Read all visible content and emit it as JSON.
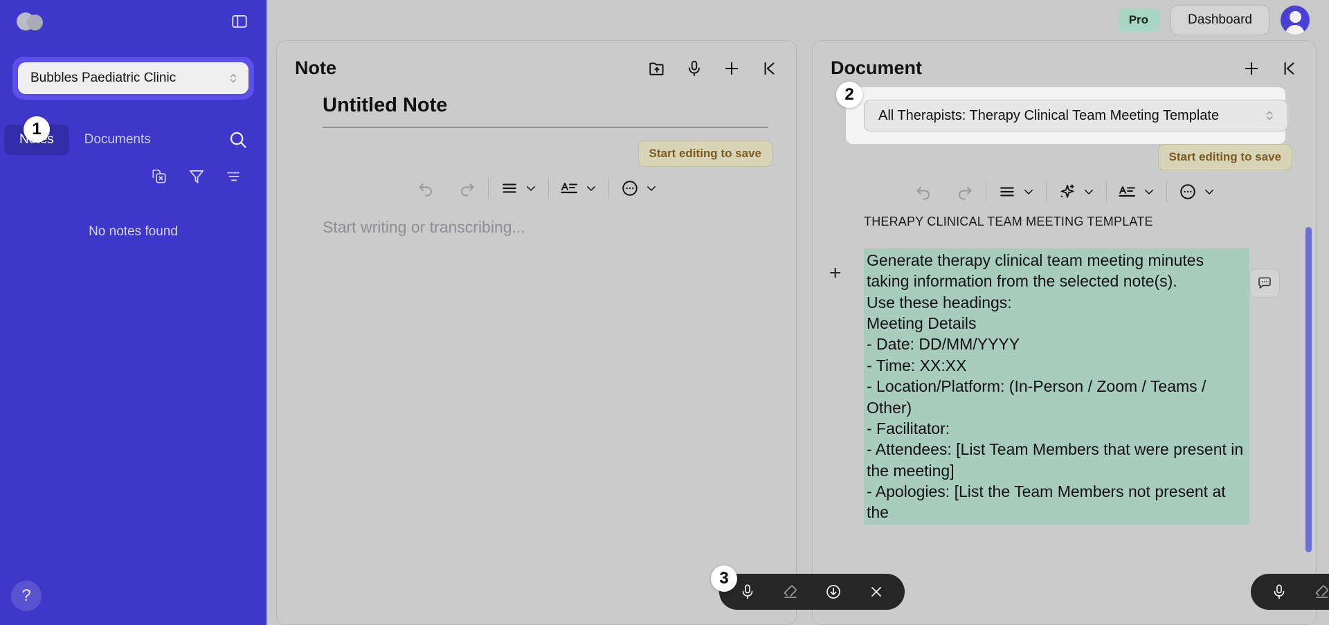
{
  "sidebar": {
    "logo_name": "bubbles-logo",
    "panel_toggle_name": "toggle-sidebar-icon",
    "clinic_selector": {
      "value": "Bubbles Paediatric Clinic",
      "badge": "1"
    },
    "tabs": [
      {
        "label": "Notes",
        "active": true
      },
      {
        "label": "Documents",
        "active": false
      }
    ],
    "search_icon": "search-icon",
    "tools": [
      {
        "name": "clear-selection-icon"
      },
      {
        "name": "filter-icon"
      },
      {
        "name": "sort-icon"
      }
    ],
    "empty_state": "No notes found",
    "help_label": "?"
  },
  "topbar": {
    "plan_badge": "Pro",
    "dashboard_label": "Dashboard",
    "avatar_name": "user-avatar"
  },
  "note_panel": {
    "title": "Note",
    "head_icons": [
      "folder-upload-icon",
      "microphone-icon",
      "plus-icon",
      "collapse-left-icon"
    ],
    "note_title": "Untitled Note",
    "save_badge": "Start editing to save",
    "toolbar": [
      {
        "name": "undo-icon",
        "dim": true
      },
      {
        "name": "redo-icon",
        "dim": true
      },
      {
        "name": "list-format-icon",
        "dim": false
      },
      {
        "name": "text-style-icon",
        "dim": false
      },
      {
        "name": "more-options-icon",
        "dim": false
      }
    ],
    "placeholder": "Start writing or transcribing...",
    "recorder_badge": "3",
    "recorder_buttons": [
      "microphone-icon",
      "eraser-icon",
      "download-icon",
      "close-icon"
    ]
  },
  "document_panel": {
    "title": "Document",
    "head_icons": [
      "plus-icon",
      "collapse-left-icon"
    ],
    "template_selector": {
      "value": "All Therapists: Therapy Clinical Team Meeting Template",
      "badge": "2"
    },
    "save_badge": "Start editing to save",
    "toolbar": [
      {
        "name": "undo-icon",
        "dim": true
      },
      {
        "name": "redo-icon",
        "dim": true
      },
      {
        "name": "list-format-icon",
        "dim": false
      },
      {
        "name": "ai-sparkle-icon",
        "dim": false
      },
      {
        "name": "text-style-icon",
        "dim": false
      },
      {
        "name": "more-options-icon",
        "dim": false
      }
    ],
    "doc_heading": "THERAPY CLINICAL TEAM MEETING TEMPLATE",
    "highlighted_lines": [
      "Generate therapy clinical team meeting minutes taking information from the selected note(s).",
      "Use these headings:",
      "Meeting Details",
      "- Date: DD/MM/YYYY",
      "- Time: XX:XX",
      "- Location/Platform: (In-Person / Zoom / Teams / Other)",
      "- Facilitator:",
      "- Attendees: [List Team Members that were present in the meeting]",
      "- Apologies: [List the Team Members not present at the"
    ],
    "comment_icon": "comment-icon",
    "recorder_buttons": [
      "microphone-icon",
      "eraser-icon",
      "download-icon",
      "close-icon"
    ]
  },
  "colors": {
    "sidebar_bg": "#3f37c9",
    "accent_halo": "#5b50ec",
    "app_bg": "#c9c9c9",
    "panel_bg": "#cbcbcb",
    "highlight_green": "#a8cdbf",
    "pro_badge": "#a8d5c4",
    "save_badge_bg": "#d8d4b8",
    "save_badge_text": "#7a5a1e",
    "scrollbar": "#6b6fd0",
    "recorder_bg": "#262626"
  }
}
